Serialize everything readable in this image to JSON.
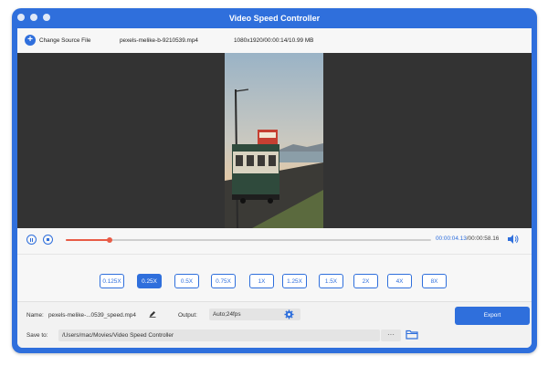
{
  "window": {
    "title": "Video Speed Controller"
  },
  "toolbar": {
    "change_source_label": "Change Source File",
    "file_name": "pexels-melike-b-9210539.mp4",
    "file_info": "1080x1920/00:00:14/10.99 MB"
  },
  "player": {
    "current_time": "00:00:04.13",
    "total_time": "/00:00:58.16",
    "progress_fraction": 0.12
  },
  "speeds": {
    "items": [
      "0.125X",
      "0.25X",
      "0.5X",
      "0.75X",
      "1X",
      "1.25X",
      "1.5X",
      "2X",
      "4X",
      "8X"
    ],
    "selected": "0.25X"
  },
  "output_settings": {
    "name_label": "Name:",
    "name_value": "pexels-melike-...0539_speed.mp4",
    "output_label": "Output:",
    "output_value": "Auto;24fps",
    "save_label": "Save to:",
    "save_path": "/Users/mac/Movies/Video Speed Controller",
    "browse_label": "···",
    "export_label": "Export"
  },
  "colors": {
    "accent": "#2f6fdc",
    "progress": "#e85b46",
    "video_bg": "#333333"
  },
  "icons": {
    "add": "plus-circle-icon",
    "pause": "pause-icon",
    "stop": "stop-icon",
    "volume": "volume-icon",
    "edit": "pencil-icon",
    "settings": "gear-icon",
    "folder": "folder-icon"
  }
}
